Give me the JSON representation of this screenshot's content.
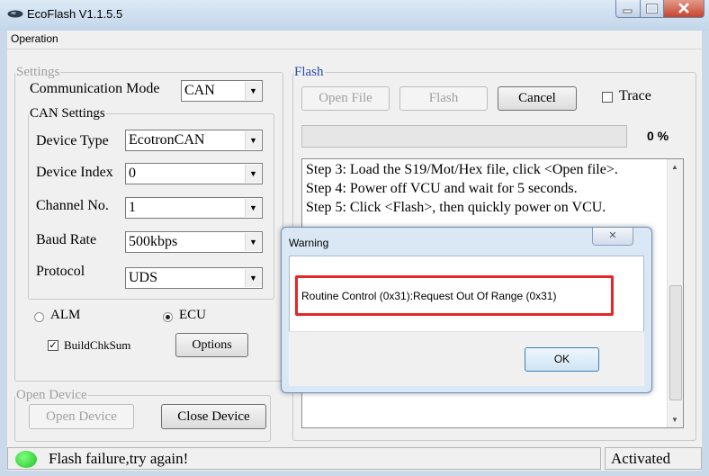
{
  "window": {
    "title": "EcoFlash V1.1.5.5"
  },
  "menu": {
    "items": [
      "Operation"
    ]
  },
  "settings": {
    "legend": "Settings",
    "comm_mode_label": "Communication Mode",
    "comm_mode_value": "CAN",
    "can": {
      "legend": "CAN Settings",
      "device_type_label": "Device Type",
      "device_type_value": "EcotronCAN",
      "device_index_label": "Device Index",
      "device_index_value": "0",
      "channel_label": "Channel No.",
      "channel_value": "1",
      "baud_label": "Baud Rate",
      "baud_value": "500kbps",
      "protocol_label": "Protocol",
      "protocol_value": "UDS"
    },
    "target": {
      "alm_label": "ALM",
      "ecu_label": "ECU",
      "selected": "ECU"
    },
    "buildchksum_label": "BuildChkSum",
    "buildchksum_checked": true,
    "options_button": "Options"
  },
  "open_device": {
    "legend": "Open Device",
    "open_button": "Open Device",
    "close_button": "Close Device"
  },
  "flash": {
    "legend": "Flash",
    "open_file_button": "Open File",
    "flash_button": "Flash",
    "cancel_button": "Cancel",
    "trace_label": "Trace",
    "trace_checked": false,
    "progress_percent": 0,
    "progress_text": "0 %",
    "log_lines": [
      "Step 3: Load the S19/Mot/Hex file, click <Open file>.",
      "Step 4: Power off VCU and wait for 5 seconds.",
      "Step 5: Click <Flash>, then quickly power on VCU."
    ]
  },
  "status": {
    "message": "Flash failure,try again!",
    "state": "Activated",
    "led_color": "#22c022"
  },
  "dialog": {
    "title": "Warning",
    "message": "Routine Control (0x31):Request Out Of Range (0x31)",
    "ok_button": "OK"
  },
  "colors": {
    "highlight": "#e8262a",
    "legend_blue": "#2a4bb3"
  }
}
